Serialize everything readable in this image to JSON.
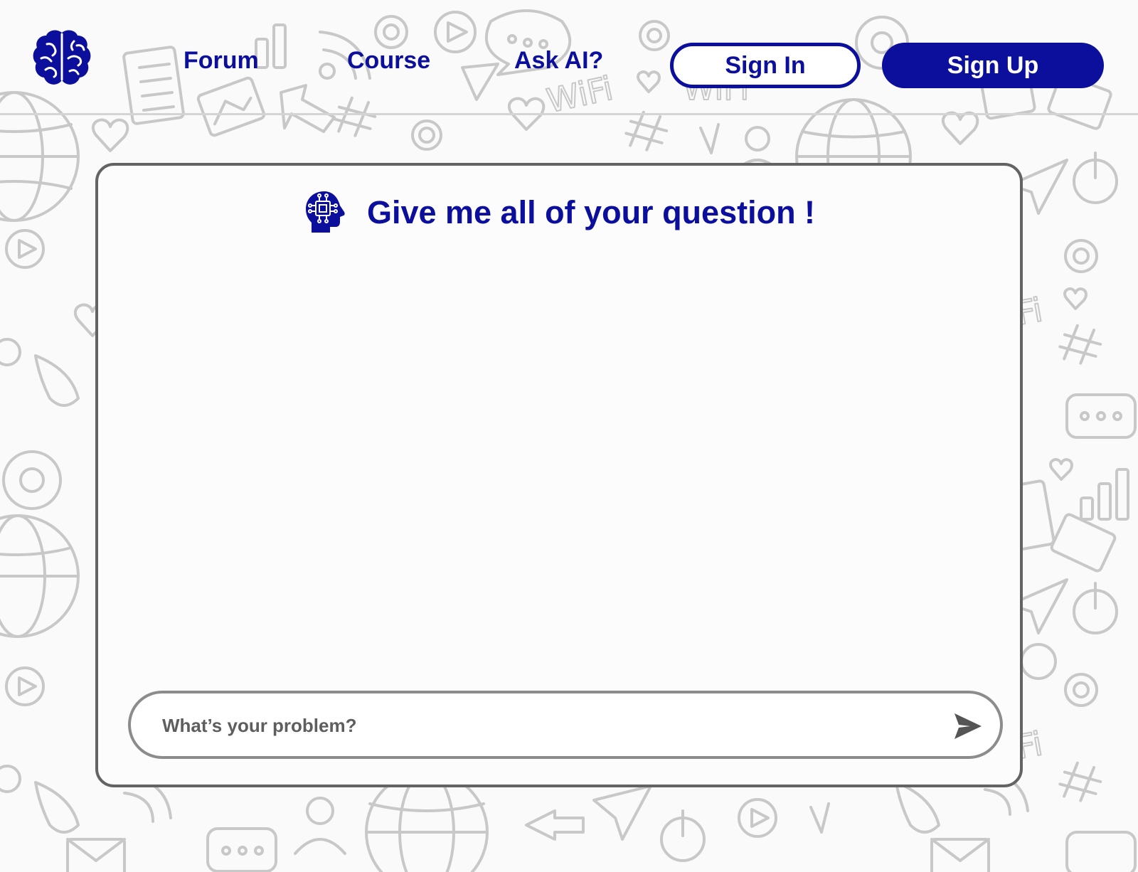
{
  "nav": {
    "logo_icon": "brain-icon",
    "links": [
      {
        "label": "Forum"
      },
      {
        "label": "Course"
      },
      {
        "label": "Ask AI?"
      }
    ],
    "sign_in_label": "Sign In",
    "sign_up_label": "Sign Up"
  },
  "chat": {
    "title": "Give me all of your question !",
    "title_icon": "ai-head-icon",
    "input": {
      "placeholder": "What’s your problem?",
      "value": ""
    },
    "send_icon": "send-icon"
  },
  "colors": {
    "brand": "#0b0f9c",
    "card_border": "#636363",
    "input_border": "#8c8c8c",
    "doodle": "#c8c8c8",
    "background": "#fafafa"
  }
}
